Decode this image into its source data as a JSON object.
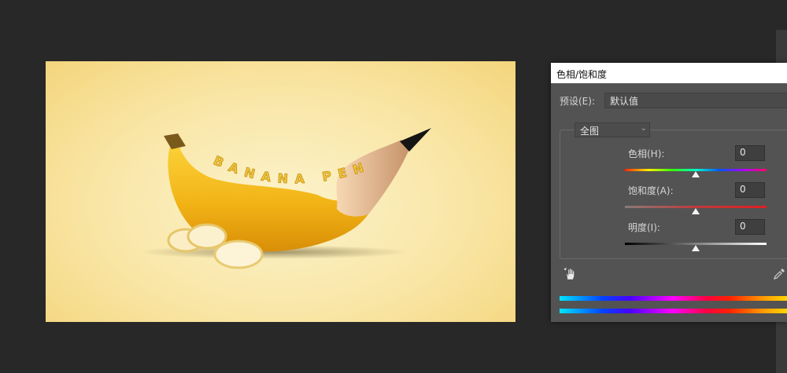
{
  "canvas": {
    "artwork_text": "BANANA PEN"
  },
  "dialog": {
    "title": "色相/饱和度",
    "preset_label": "预设(E):",
    "preset_value": "默认值",
    "channel_value": "全图",
    "hue": {
      "label": "色相(H):",
      "value": "0",
      "level": 0.5
    },
    "saturation": {
      "label": "饱和度(A):",
      "value": "0",
      "level": 0.5
    },
    "lightness": {
      "label": "明度(I):",
      "value": "0",
      "level": 0.5
    }
  },
  "icons": {
    "hand_tool": "targeted-adjustment-hand-icon",
    "eyedropper": "eyedropper-icon",
    "dropdown": "chevron-down-icon"
  },
  "colors": {
    "workspace_bg": "#282828",
    "dialog_bg": "#535353",
    "canvas_bg": "#f9e6a6",
    "banana": "#f2b416",
    "text_outline": "#d59a12"
  }
}
